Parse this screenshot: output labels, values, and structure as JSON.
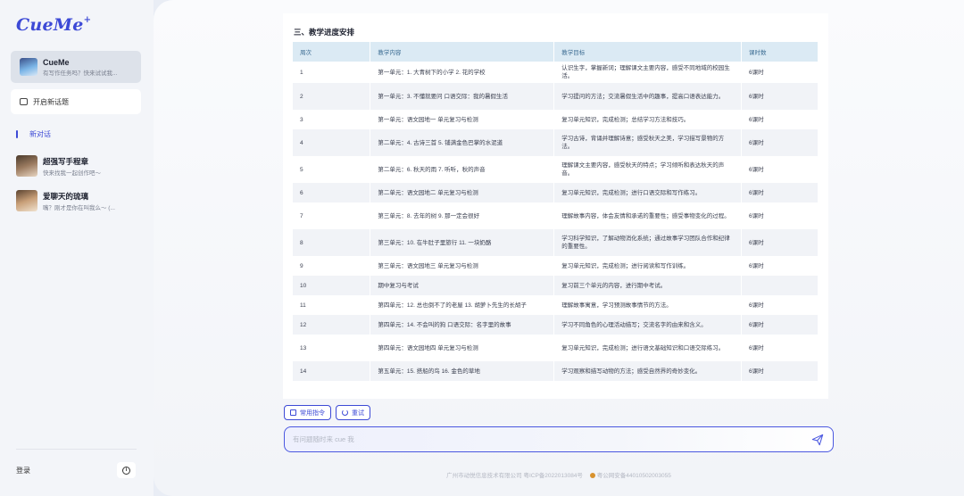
{
  "sidebar": {
    "logo": "CueMe",
    "logo_spark": "+",
    "current_agent": {
      "name": "CueMe",
      "desc": "有写作任务吗？快来试试我..."
    },
    "new_topic_label": "开启新话题",
    "active_conversation": "新对话",
    "conversations": [
      {
        "name": "超强写手程章",
        "desc": "快来找我一起创作吧～"
      },
      {
        "name": "爱聊天的琉璃",
        "desc": "嘴？刚才是你在叫我么～ (..."
      }
    ],
    "login_label": "登录",
    "info_label": "i"
  },
  "document": {
    "section_title": "三、教学进度安排",
    "columns": [
      "周次",
      "教学内容",
      "教学目标",
      "课时数"
    ],
    "rows": [
      [
        "1",
        "第一单元：1. 大青树下的小学 2. 花的学校",
        "认识生字，掌握新词；理解课文主要内容，感受不同地域的校园生活。",
        "6课时"
      ],
      [
        "2",
        "第一单元：3. 不懂就要问 口语交际：我的暑假生活",
        "学习提问的方法；交流暑假生活中的趣事，提高口语表达能力。",
        "6课时"
      ],
      [
        "3",
        "第一单元：语文园地一 单元复习与检测",
        "复习单元知识，完成检测；总结学习方法和技巧。",
        "6课时"
      ],
      [
        "4",
        "第二单元：4. 古诗三首 5. 铺满金色巴掌的水泥道",
        "学习古诗，背诵并理解诗意；感受秋天之美，学习描写景物的方法。",
        "6课时"
      ],
      [
        "5",
        "第二单元：6. 秋天的雨 7. 听听，秋的声音",
        "理解课文主要内容，感受秋天的特点；学习倾听和表达秋天的声音。",
        "6课时"
      ],
      [
        "6",
        "第二单元：语文园地二 单元复习与检测",
        "复习单元知识，完成检测；进行口语交际和写作练习。",
        "6课时"
      ],
      [
        "7",
        "第三单元：8. 去年的树 9. 那一定会很好",
        "理解故事内容，体会友情和承诺的重要性；感受事物变化的过程。",
        "6课时"
      ],
      [
        "8",
        "第三单元：10. 在牛肚子里旅行 11. 一块奶酪",
        "学习科学知识，了解动物消化系统；通过故事学习团队合作和纪律的重要性。",
        "6课时"
      ],
      [
        "9",
        "第三单元：语文园地三 单元复习与检测",
        "复习单元知识，完成检测；进行阅读和写作训练。",
        "6课时"
      ],
      [
        "10",
        "期中复习与考试",
        "复习前三个单元的内容，进行期中考试。",
        ""
      ],
      [
        "11",
        "第四单元：12. 总也倒不了的老屋 13. 胡萝卜先生的长胡子",
        "理解故事寓意，学习预测故事情节的方法。",
        "6课时"
      ],
      [
        "12",
        "第四单元：14. 不会叫的狗 口语交际：名字里的故事",
        "学习不同角色的心理活动描写；交流名字的由来和含义。",
        "6课时"
      ],
      [
        "13",
        "第四单元：语文园地四 单元复习与检测",
        "复习单元知识，完成检测；进行语文基础知识和口语交际练习。",
        "6课时"
      ],
      [
        "14",
        "第五单元：15. 搭船的鸟 16. 金色的草地",
        "学习观察和描写动物的方法；感受自然界的奇妙变化。",
        "6课时"
      ]
    ]
  },
  "actions": {
    "common_commands": "常用指令",
    "retry": "重试"
  },
  "input": {
    "placeholder": "有问题随时来 cue 我",
    "value": ""
  },
  "footer": {
    "company": "广州市动悦信息技术有限公司",
    "icp": "粤ICP备2022013084号",
    "police": "粤公网安备44010502003055"
  },
  "colors": {
    "accent": "#3d4ad6",
    "table_header_bg": "#dbeaf4",
    "table_header_text": "#3d6d93"
  },
  "icons": [
    "new-topic-icon",
    "info-icon",
    "commands-icon",
    "retry-icon",
    "send-icon",
    "police-badge-icon"
  ]
}
